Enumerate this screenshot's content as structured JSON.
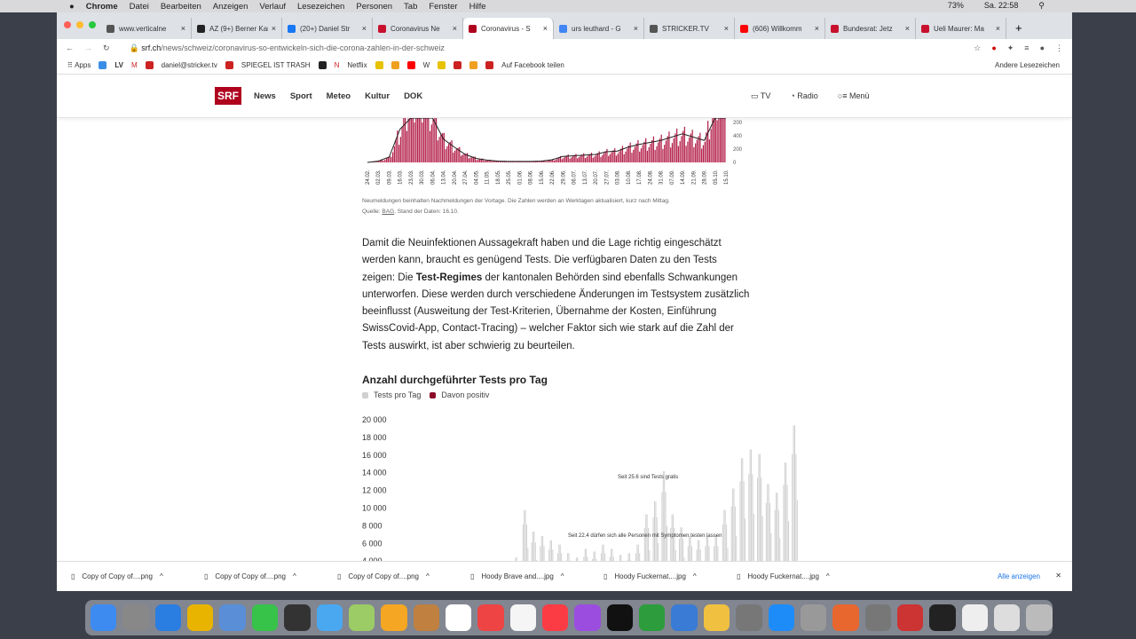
{
  "menubar": {
    "app": "Chrome",
    "items": [
      "Datei",
      "Bearbeiten",
      "Anzeigen",
      "Verlauf",
      "Lesezeichen",
      "Personen",
      "Tab",
      "Fenster",
      "Hilfe"
    ],
    "battery": "73%",
    "clock": "Sa. 22:58"
  },
  "tabs": [
    {
      "title": "www.verticalne",
      "color": "#555"
    },
    {
      "title": "AZ (9+) Berner Kan",
      "color": "#222"
    },
    {
      "title": "(20+) Daniel Str",
      "color": "#1877f2"
    },
    {
      "title": "Coronavirus Ne",
      "color": "#c8102e"
    },
    {
      "title": "Coronavirus - S",
      "color": "#af001d",
      "active": true
    },
    {
      "title": "urs leuthard - G",
      "color": "#4285f4"
    },
    {
      "title": "STRICKER.TV",
      "color": "#555"
    },
    {
      "title": "(606) Willkomm",
      "color": "#ff0000"
    },
    {
      "title": "Bundesrat: Jetz",
      "color": "#c8102e"
    },
    {
      "title": "Ueli Maurer: Ma",
      "color": "#c8102e"
    }
  ],
  "address": {
    "domain": "srf.ch",
    "path": "/news/schweiz/coronavirus-so-entwickeln-sich-die-corona-zahlen-in-der-schweiz"
  },
  "bookmarks": {
    "apps": "Apps",
    "items": [
      "daniel@stricker.tv",
      "SPIEGEL IST TRASH",
      "Netflix",
      "Auf Facebook teilen"
    ],
    "other": "Andere Lesezeichen"
  },
  "srf": {
    "logo": "SRF",
    "nav": [
      "News",
      "Sport",
      "Meteo",
      "Kultur",
      "DOK"
    ],
    "right": [
      "TV",
      "Radio",
      "Menü"
    ]
  },
  "article": {
    "caption1": "Neumeldungen beinhalten Nachmeldungen der Vortage. Die Zahlen werden an Werktagen aktualisiert, kurz nach Mittag.",
    "source_label": "Quelle: ",
    "source": "BAG",
    "source_rest": ", Stand der Daten: 16.10.",
    "p_a": "Damit die Neuinfektionen Aussagekraft haben und die Lage richtig eingeschätzt werden kann, braucht es genügend Tests. Die verfügbaren Daten zu den Tests zeigen: Die ",
    "p_bold": "Test-Regimes",
    "p_b": " der kantonalen Behörden sind ebenfalls Schwankungen unterworfen. Diese werden durch verschiedene Änderungen im Testsystem zusätzlich beeinflusst (Ausweitung der Test-Kriterien, Übernahme der Kosten, Einführung SwissCovid-App, Contact-Tracing) – welcher Faktor sich wie stark auf die Zahl der Tests auswirkt, ist aber schwierig zu beurteilen."
  },
  "chart_data": [
    {
      "type": "bar",
      "title": "",
      "xlabel": "",
      "ylabel": "",
      "categories": [
        "24.02.",
        "02.03.",
        "09.03.",
        "16.03.",
        "23.03.",
        "30.03.",
        "06.04.",
        "13.04.",
        "20.04.",
        "27.04.",
        "04.05.",
        "11.05.",
        "18.05.",
        "25.05.",
        "01.06.",
        "08.06.",
        "15.06.",
        "22.06.",
        "29.06.",
        "06.07.",
        "13.07.",
        "20.07.",
        "27.07.",
        "03.08.",
        "10.08.",
        "17.08.",
        "24.08.",
        "31.08.",
        "07.09.",
        "14.09.",
        "21.09.",
        "28.09.",
        "05.10.",
        "15.10."
      ],
      "values": [
        0,
        20,
        80,
        500,
        1000,
        1000,
        700,
        350,
        230,
        120,
        60,
        35,
        20,
        15,
        15,
        15,
        20,
        40,
        90,
        100,
        110,
        120,
        160,
        170,
        230,
        270,
        300,
        330,
        380,
        430,
        380,
        330,
        900,
        2000
      ],
      "yticks": [
        0,
        200,
        400,
        "200"
      ],
      "bar_color": "#b5234d",
      "line_color": "#222"
    },
    {
      "type": "bar",
      "title": "Anzahl durchgeführter Tests pro Tag",
      "legend": [
        "Tests pro Tag",
        "Davon positiv"
      ],
      "legend_colors": [
        "#d0d0d0",
        "#8b0a2a"
      ],
      "legend_placement": "top-left",
      "yticks": [
        "20 000",
        "18 000",
        "16 000",
        "14 000",
        "12 000",
        "10 000",
        "8 000",
        "6 000",
        "4 000"
      ],
      "ylim": [
        4000,
        20000
      ],
      "values": [
        4500,
        10000,
        7500,
        7000,
        6500,
        6000,
        5000,
        4500,
        5500,
        5200,
        6000,
        5500,
        4800,
        5000,
        6000,
        9500,
        11000,
        14500,
        9500,
        8000,
        7000,
        6500,
        7000,
        7000,
        10000,
        12500,
        16000,
        17000,
        16500,
        13000,
        12000,
        15500,
        19800
      ],
      "annotations": [
        "Seit 25.6 sind Tests gratis",
        "Seit 22.4 dürfen sich alle Personen mit Symptomen testen lassen"
      ]
    }
  ],
  "downloads": {
    "items": [
      "Copy of Copy of....png",
      "Copy of Copy of....png",
      "Copy of Copy of....png",
      "Hoody Brave and....jpg",
      "Hoody Fuckernat....jpg",
      "Hoody Fuckernat....jpg"
    ],
    "show_all": "Alle anzeigen"
  }
}
